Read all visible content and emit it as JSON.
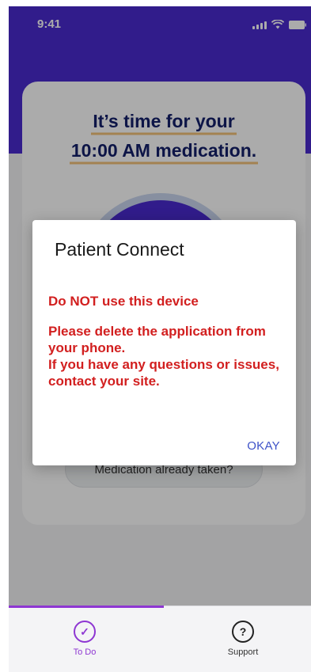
{
  "status_bar": {
    "time": "9:41"
  },
  "reminder": {
    "line1": "It’s time for your",
    "line2": "10:00 AM medication."
  },
  "taken_button": {
    "label": "Medication already taken?"
  },
  "tabs": [
    {
      "label": "To Do",
      "icon": "check-circle-icon",
      "active": true
    },
    {
      "label": "Support",
      "icon": "question-circle-icon",
      "active": false
    }
  ],
  "dialog": {
    "title": "Patient Connect",
    "message_line1": "Do NOT use this device",
    "message_line2": "Please delete the application from your phone.",
    "message_line3": "If you have any questions or issues, contact your site.",
    "ok_label": "OKAY"
  },
  "colors": {
    "brand_purple": "#4a2bd0",
    "accent_purple": "#8e36d2",
    "warning_red": "#d21f1f",
    "link_blue": "#3d52c8"
  }
}
